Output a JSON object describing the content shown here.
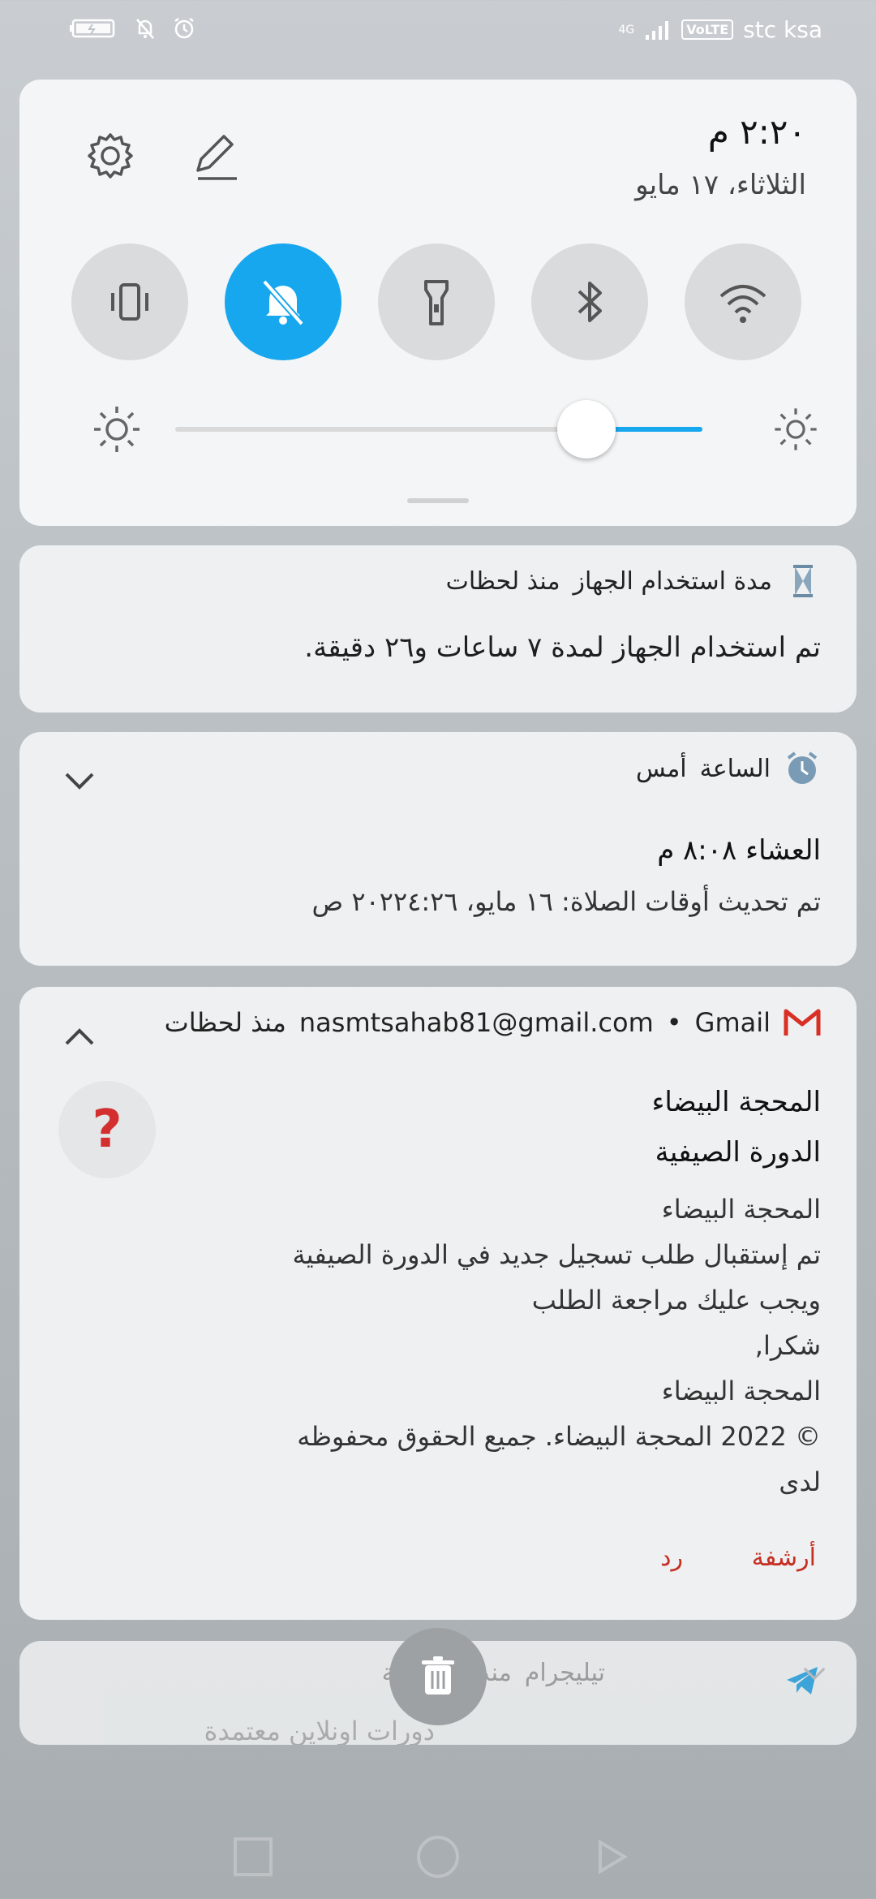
{
  "status_bar": {
    "network_type": "4G",
    "volte": "VoLTE",
    "carrier": "stc ksa"
  },
  "quick_settings": {
    "time": "٢:٢٠ م",
    "date": "الثلاثاء، ١٧ مايو",
    "tiles": [
      "vibrate",
      "do-not-disturb",
      "flashlight",
      "bluetooth",
      "wifi"
    ],
    "brightness_level": 0.22,
    "accent_color": "#17a7ef"
  },
  "notifications": [
    {
      "app": "مدة استخدام الجهاز",
      "time": "منذ لحظات",
      "body": "تم استخدام الجهاز لمدة ٧ ساعات و٢٦ دقيقة."
    },
    {
      "app": "الساعة",
      "time": "أمس",
      "title": "العشاء ٨:٠٨ م",
      "body": "تم تحديث أوقات الصلاة: ١٦ مايو، ٢٠٢٢٤:٢٦ ص"
    },
    {
      "app": "Gmail",
      "separator": "•",
      "account": "nasmtsahab81@gmail.com",
      "time": "منذ لحظات",
      "sender": "المحجة البيضاء",
      "subject": "الدورة الصيفية",
      "lines": [
        "المحجة البيضاء",
        "تم إستقبال طلب تسجيل جديد في الدورة الصيفية",
        "ويجب عليك مراجعة الطلب",
        "شكرا,",
        "المحجة البيضاء",
        "© 2022 المحجة البيضاء. جميع الحقوق محفوظه",
        "لدى"
      ],
      "avatar_glyph": "?",
      "actions": {
        "archive": "أرشفة",
        "reply": "رد"
      }
    },
    {
      "app": "تيليجرام",
      "time": "منذ ١٩ دقيقة",
      "body": "دورات اونلاين معتمدة"
    }
  ]
}
